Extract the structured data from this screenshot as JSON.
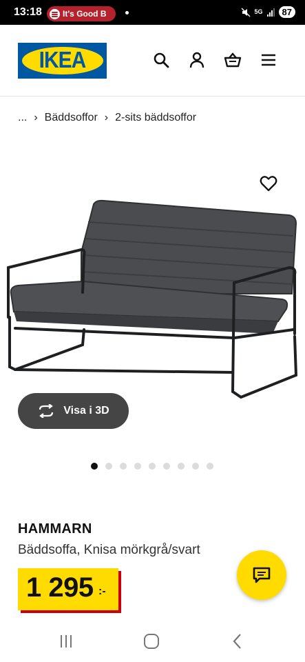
{
  "status_bar": {
    "time": "13:18",
    "media_text": "It's Good B",
    "network": "5G",
    "battery": "87"
  },
  "header": {
    "logo_text": "IKEA",
    "icons": [
      "search-icon",
      "account-icon",
      "basket-icon",
      "menu-icon"
    ]
  },
  "breadcrumb": {
    "ellipsis": "...",
    "items": [
      "Bäddsoffor",
      "2-sits bäddsoffor"
    ],
    "separator": "›"
  },
  "product": {
    "image_alt_icon": "sofa-bed",
    "view_3d_label": "Visa i 3D",
    "image_count": 9,
    "active_image": 1,
    "name": "HAMMARN",
    "description": "Bäddsoffa, Knisa mörkgrå/svart",
    "price": "1 295",
    "price_suffix": ":-"
  },
  "colors": {
    "ikea_blue": "#0058a3",
    "ikea_yellow": "#ffdb00",
    "price_shadow": "#cc0008",
    "button_dark": "#454545"
  }
}
